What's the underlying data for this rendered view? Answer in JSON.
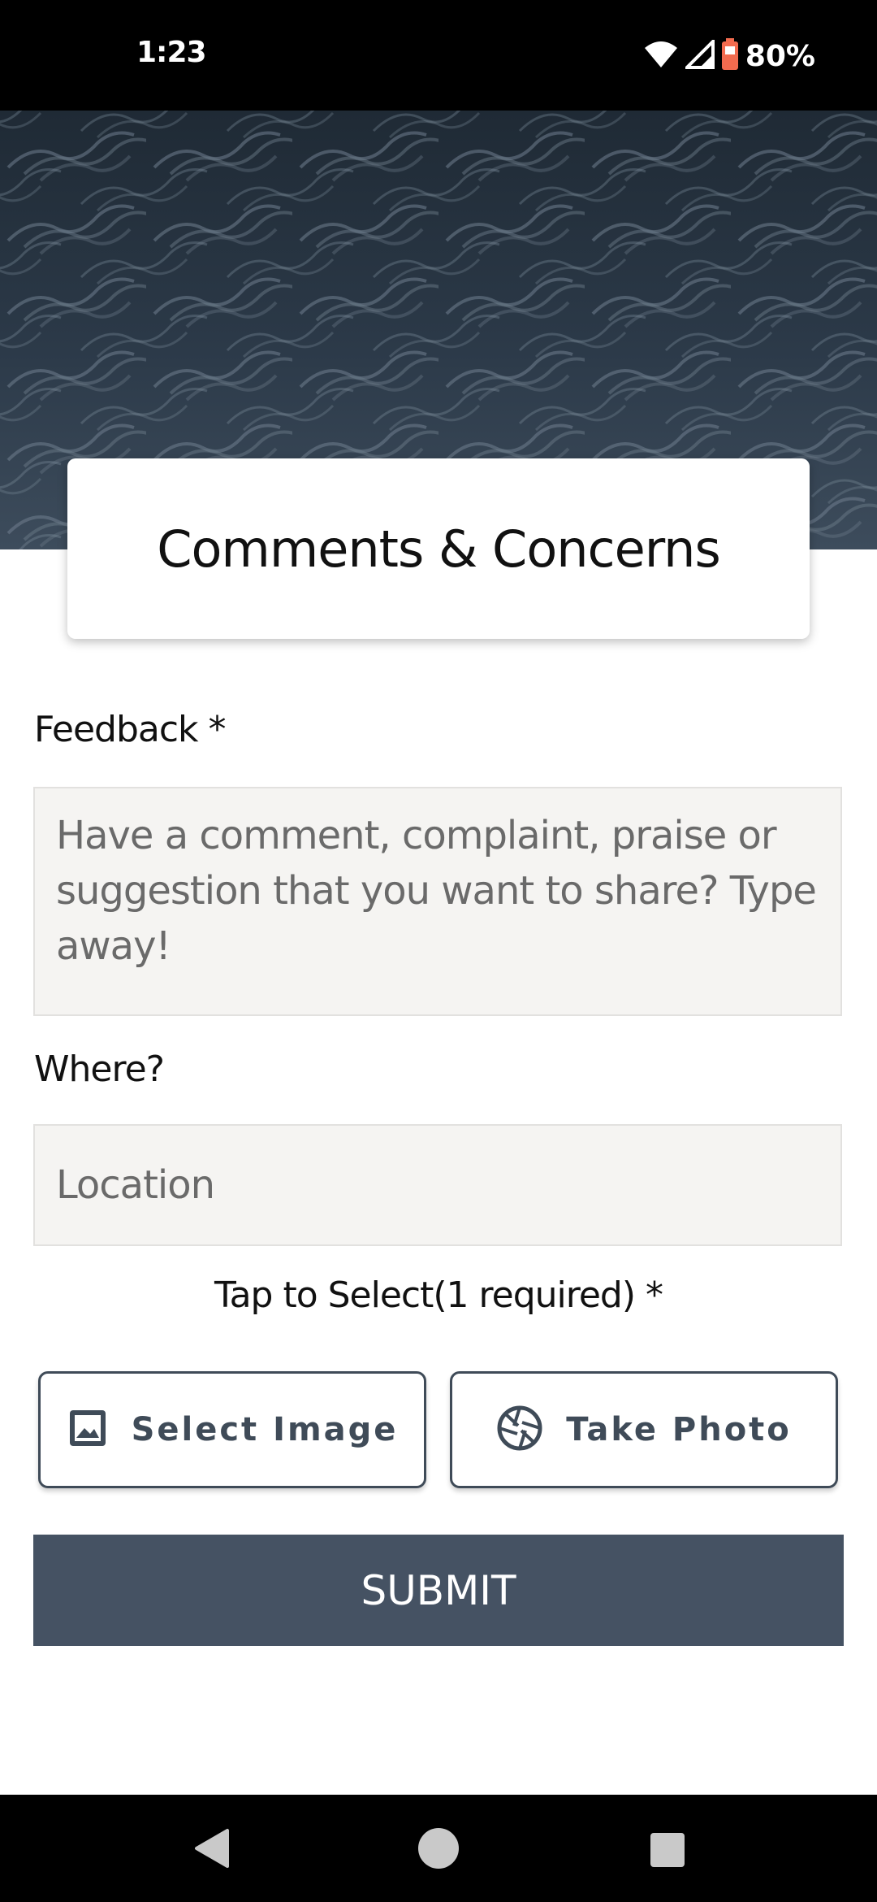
{
  "status_bar": {
    "time": "1:23",
    "battery": "80%",
    "icons": [
      "wifi-icon",
      "cell-signal-icon",
      "battery-icon"
    ]
  },
  "header": {
    "title": "Comments & Concerns"
  },
  "form": {
    "feedback_label": "Feedback *",
    "feedback_placeholder": "Have a comment, complaint, praise or suggestion that you want to share? Type away!",
    "where_label": "Where?",
    "location_placeholder": "Location",
    "tap_to_select": "Tap to Select(1 required) *",
    "select_image_label": "Select Image",
    "take_photo_label": "Take Photo",
    "submit_label": "SUBMIT"
  },
  "nav": {
    "icons": [
      "back-icon",
      "home-icon",
      "recents-icon"
    ]
  },
  "colors": {
    "primary": "#455263",
    "button_outline": "#3f4b58",
    "input_bg": "#f5f4f2",
    "header_bg": "#2c3a49"
  }
}
